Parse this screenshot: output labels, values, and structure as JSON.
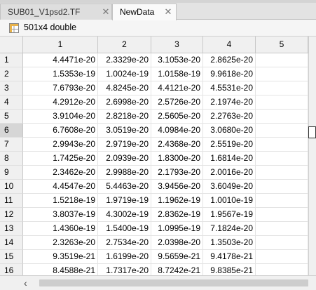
{
  "tabs": [
    {
      "label": "SUB01_V1psd2.TF",
      "active": false
    },
    {
      "label": "NewData",
      "active": true
    }
  ],
  "variable": {
    "title": "501x4 double",
    "icon": "table-variable-icon"
  },
  "grid": {
    "columns": [
      "1",
      "2",
      "3",
      "4",
      "5"
    ],
    "selected_row": "6",
    "rows": [
      {
        "index": "1",
        "values": [
          "4.4471e-20",
          "2.3329e-20",
          "3.1053e-20",
          "2.8625e-20",
          ""
        ]
      },
      {
        "index": "2",
        "values": [
          "1.5353e-19",
          "1.0024e-19",
          "1.0158e-19",
          "9.9618e-20",
          ""
        ]
      },
      {
        "index": "3",
        "values": [
          "7.6793e-20",
          "4.8245e-20",
          "4.4121e-20",
          "4.5531e-20",
          ""
        ]
      },
      {
        "index": "4",
        "values": [
          "4.2912e-20",
          "2.6998e-20",
          "2.5726e-20",
          "2.1974e-20",
          ""
        ]
      },
      {
        "index": "5",
        "values": [
          "3.9104e-20",
          "2.8218e-20",
          "2.5605e-20",
          "2.2763e-20",
          ""
        ]
      },
      {
        "index": "6",
        "values": [
          "6.7608e-20",
          "3.0519e-20",
          "4.0984e-20",
          "3.0680e-20",
          ""
        ]
      },
      {
        "index": "7",
        "values": [
          "2.9943e-20",
          "2.9719e-20",
          "2.4368e-20",
          "2.5519e-20",
          ""
        ]
      },
      {
        "index": "8",
        "values": [
          "1.7425e-20",
          "2.0939e-20",
          "1.8300e-20",
          "1.6814e-20",
          ""
        ]
      },
      {
        "index": "9",
        "values": [
          "2.3462e-20",
          "2.9988e-20",
          "2.1793e-20",
          "2.0016e-20",
          ""
        ]
      },
      {
        "index": "10",
        "values": [
          "4.4547e-20",
          "5.4463e-20",
          "3.9456e-20",
          "3.6049e-20",
          ""
        ]
      },
      {
        "index": "11",
        "values": [
          "1.5218e-19",
          "1.9719e-19",
          "1.1962e-19",
          "1.0010e-19",
          ""
        ]
      },
      {
        "index": "12",
        "values": [
          "3.8037e-19",
          "4.3002e-19",
          "2.8362e-19",
          "1.9567e-19",
          ""
        ]
      },
      {
        "index": "13",
        "values": [
          "1.4360e-19",
          "1.5400e-19",
          "1.0995e-19",
          "7.1824e-20",
          ""
        ]
      },
      {
        "index": "14",
        "values": [
          "2.3263e-20",
          "2.7534e-20",
          "2.0398e-20",
          "1.3503e-20",
          ""
        ]
      },
      {
        "index": "15",
        "values": [
          "9.3519e-21",
          "1.6199e-20",
          "9.5659e-21",
          "9.4178e-21",
          ""
        ]
      },
      {
        "index": "16",
        "values": [
          "8.4588e-21",
          "1.7317e-20",
          "8.7242e-21",
          "9.8385e-21",
          ""
        ]
      }
    ]
  },
  "scroll": {
    "left_arrow": "‹",
    "left_arrow_icon": "chevron-left-icon"
  }
}
